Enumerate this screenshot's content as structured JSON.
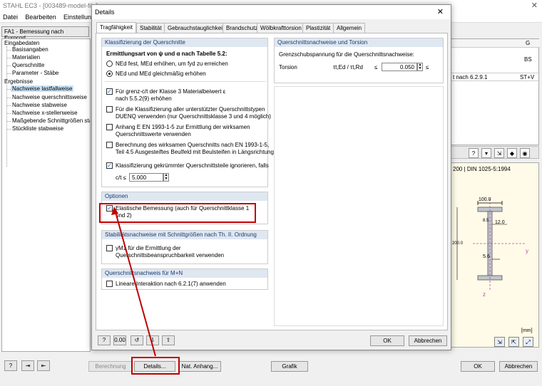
{
  "app": {
    "title": "STAHL EC3 - [003489-model-file]",
    "close_icon": "close-icon",
    "menu": [
      "Datei",
      "Bearbeiten",
      "Einstellungen"
    ]
  },
  "case_select": "FA1 - Bemessung nach Eurocod",
  "tree": {
    "eingabe": "Eingabedaten",
    "eingabe_items": [
      "Basisangaben",
      "Materialien",
      "Querschnitte",
      "Parameter - Stäbe"
    ],
    "ergebnisse": "Ergebnisse",
    "ergebnis_items": [
      "Nachweise lastfallweise",
      "Nachweise querschnittsweise",
      "Nachweise stabweise",
      "Nachweise x-stellenweise",
      "Maßgebende Schnittgrößen sta",
      "Stückliste stabweise"
    ]
  },
  "right_table": {
    "col_g": "G",
    "cell_bs": "BS",
    "row_text": "t nach 6.2.9.1",
    "row_val": "ST+V"
  },
  "right_toolbar_icons": [
    "question-icon",
    "filter-icon",
    "export-icon",
    "color-icon",
    "view-icon"
  ],
  "drawing": {
    "title": "200 | DIN 1025-5:1994",
    "dim_flange_width": "100.0",
    "dim_flange_thick": "12.0",
    "dim_web_thick": "5.6",
    "dim_top": "8.5",
    "dim_height": "200.0",
    "axis_y": "y",
    "axis_z": "z",
    "unit": "[mm]",
    "buttons": [
      "zoom-icon",
      "print-icon",
      "fit-icon"
    ]
  },
  "bottom": {
    "berechnung": "Berechnung",
    "details": "Details...",
    "nat_anhang": "Nat. Anhang...",
    "grafik": "Grafik",
    "ok": "OK",
    "abbrechen": "Abbrechen",
    "icons": [
      "help-icon",
      "export-icon",
      "import-icon"
    ]
  },
  "dialog": {
    "title": "Details",
    "tabs": [
      "Tragfähigkeit",
      "Stabilität",
      "Gebrauchstauglichkeit",
      "Brandschutz",
      "Wölbkrafttorsion",
      "Plastizität",
      "Allgemein"
    ],
    "active_tab": 0,
    "klassifizierung": {
      "head": "Klassifizierung der Querschnitte",
      "subtitle": "Ermittlungsart von ψ und α nach Tabelle 5.2:",
      "radio1": "NEd fest, MEd erhöhen, um fyd zu erreichen",
      "radio2": "NEd und MEd gleichmäßig erhöhen",
      "radio_selected": 2,
      "cb1_l1": "Für grenz-c/t der Klasse 3 Materialbeiwert ε",
      "cb1_l2": "nach 5.5.2(9) erhöhen",
      "cb1_checked": true,
      "cb2_l1": "Für die Klassifizierung aller unterstützter Querschnittstypen",
      "cb2_l2": "DUENQ verwenden (nur Querschnittsklasse 3 und 4 möglich)",
      "cb2_checked": false,
      "cb3_l1": "Anhang E EN 1993-1-5 zur Ermittlung der wirksamen",
      "cb3_l2": "Querschnittswerte verwenden",
      "cb3_checked": false,
      "cb4_l1": "Berechnung des wirksamen Querschnitts nach EN 1993-1-5,",
      "cb4_l2": "Teil 4.5 Ausgesteiftes Beulfeld mit Beulsteifen in Längsrichtung",
      "cb4_checked": false,
      "cb5": "Klassifizierung gekrümmter Querschnittsteile ignorieren, falls",
      "cb5_checked": true,
      "ct_label": "c/t ≤",
      "ct_value": "5.000"
    },
    "optionen": {
      "head": "Optionen",
      "cb_l1": "Elastische Bemessung (auch für Querschnittklasse 1",
      "cb_l2": "und 2)",
      "checked": true
    },
    "stabilitaet": {
      "head": "Stabilitätsnachweise mit Schnittgrößen nach Th. II. Ordnung",
      "cb_l1": "γM1 für die Ermittlung der",
      "cb_l2": "Querschnittsbeanspruchbarkeit verwenden",
      "checked": false
    },
    "qsn": {
      "head": "Querschnittsnachweis für M+N",
      "cb": "Lineare Interaktion nach 6.2.1(7) anwenden",
      "checked": false
    },
    "torsion": {
      "head": "Querschnittsnachweise und Torsion",
      "subtitle": "Grenzschubspannung für die Querschnittsnachweise:",
      "label": "Torsion",
      "formula": "τt,Ed / τt,Rd",
      "op": "≤",
      "value": "0.050",
      "op2": "≤"
    },
    "footer_icons": [
      "help-icon",
      "units-icon",
      "reset-icon",
      "load-icon",
      "save-icon"
    ],
    "ok": "OK",
    "abbrechen": "Abbrechen"
  },
  "colors": {
    "highlight": "#c00000",
    "group_head": "#dfe7f1",
    "selection": "#cce4f7"
  }
}
